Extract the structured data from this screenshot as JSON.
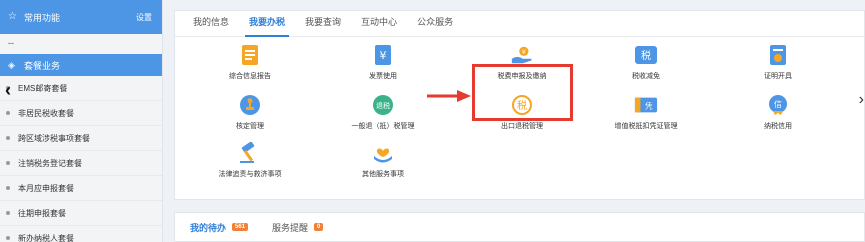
{
  "sidebar": {
    "header_title": "常用功能",
    "settings_label": "设置",
    "dots": "--",
    "section_title": "套餐业务",
    "items": [
      {
        "label": "EMS邮寄套餐"
      },
      {
        "label": "非居民税收套餐"
      },
      {
        "label": "跨区域涉税事项套餐"
      },
      {
        "label": "注销税务登记套餐"
      },
      {
        "label": "本月应申报套餐"
      },
      {
        "label": "往期申报套餐"
      },
      {
        "label": "新办纳税人套餐"
      }
    ]
  },
  "tabs": [
    {
      "label": "我的信息"
    },
    {
      "label": "我要办税"
    },
    {
      "label": "我要查询"
    },
    {
      "label": "互动中心"
    },
    {
      "label": "公众服务"
    }
  ],
  "services": [
    {
      "label": "综合信息报告",
      "icon": "document-icon"
    },
    {
      "label": "发票使用",
      "icon": "invoice-icon"
    },
    {
      "label": "税费申报及缴纳",
      "icon": "hand-coin-icon"
    },
    {
      "label": "税收减免",
      "icon": "tax-relief-icon"
    },
    {
      "label": "证明开具",
      "icon": "certificate-icon"
    },
    {
      "label": "核定管理",
      "icon": "stamp-icon"
    },
    {
      "label": "一般退（抵）税管理",
      "icon": "refund-icon"
    },
    {
      "label": "出口退税管理",
      "icon": "export-refund-icon"
    },
    {
      "label": "增值税抵扣凭证管理",
      "icon": "voucher-icon"
    },
    {
      "label": "纳税信用",
      "icon": "credit-icon"
    },
    {
      "label": "法律追责与救济事项",
      "icon": "gavel-icon"
    },
    {
      "label": "其他服务事项",
      "icon": "heart-hand-icon"
    }
  ],
  "bottom_tabs": [
    {
      "label": "我的待办",
      "count": "561"
    },
    {
      "label": "服务提醒",
      "count": "0"
    }
  ],
  "colors": {
    "accent": "#4d96e6",
    "highlight": "#e53a2f",
    "badge": "#f0813a"
  }
}
